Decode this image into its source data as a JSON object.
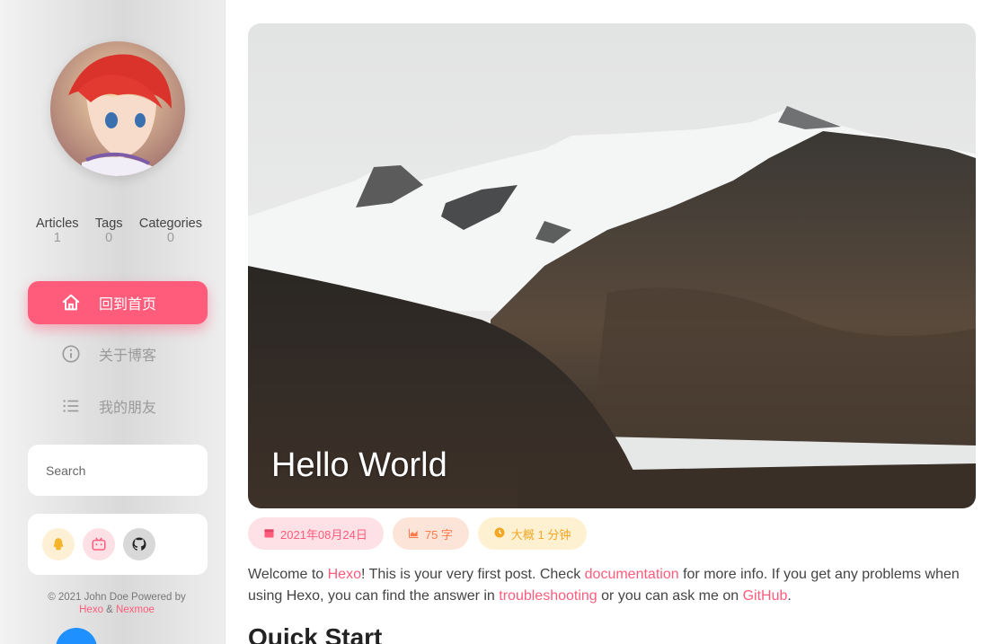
{
  "profile": {
    "stats": [
      {
        "label": "Articles",
        "value": "1"
      },
      {
        "label": "Tags",
        "value": "0"
      },
      {
        "label": "Categories",
        "value": "0"
      }
    ]
  },
  "nav": {
    "home": "回到首页",
    "about": "关于博客",
    "friends": "我的朋友"
  },
  "search": {
    "placeholder": "Search"
  },
  "social": [
    "qq-icon",
    "bilibili-icon",
    "github-icon"
  ],
  "footer": {
    "line1": "© 2021 John Doe Powered by",
    "hexo": "Hexo",
    "amp": " & ",
    "nexmoe": "Nexmoe"
  },
  "post": {
    "title": "Hello World",
    "date": "2021年08月24日",
    "words": "75 字",
    "read_time": "大概 1 分钟",
    "p1": "Welcome to ",
    "link_hexo": "Hexo",
    "p2": "! This is your very first post. Check ",
    "link_docs": "documentation",
    "p3": " for more info. If you get any problems when using Hexo, you can find the answer in ",
    "link_trouble": "troubleshooting",
    "p4": " or you can ask me on ",
    "link_github": "GitHub",
    "p5": ".",
    "heading": "Quick Start"
  },
  "colors": {
    "accent": "#ff5c7c",
    "words": "#ff7a4a",
    "read": "#f5a623"
  }
}
